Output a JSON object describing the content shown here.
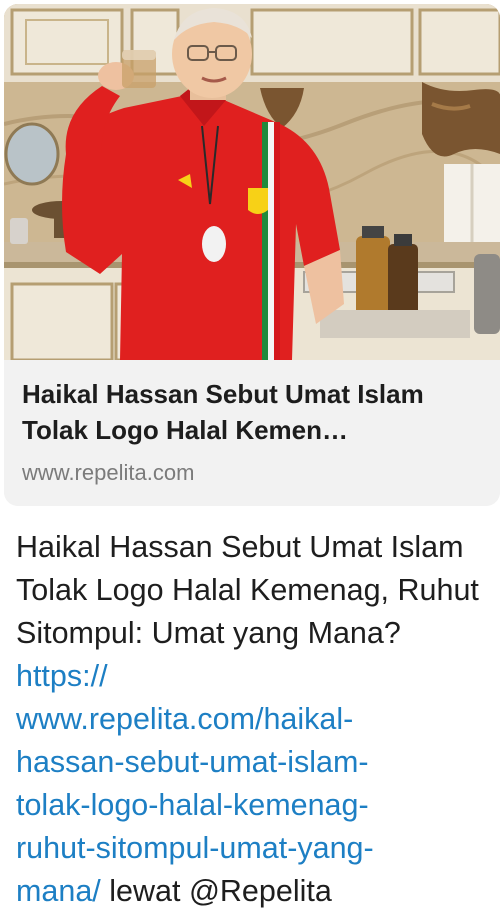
{
  "link_preview": {
    "image_description": "photo",
    "title": "Haikal Hassan Sebut Umat Islam Tolak Logo Halal Kemen…",
    "domain": "www.repelita.com"
  },
  "message": {
    "text_before_link": "Haikal Hassan Sebut Umat Islam Tolak Logo Halal Kemenag, Ruhut Sitompul: Umat yang Mana?",
    "link_line_1": "https://",
    "link_line_2": "www.repelita.com/haikal-",
    "link_line_3": "hassan-sebut-umat-islam-",
    "link_line_4": "tolak-logo-halal-kemenag-",
    "link_line_5": "ruhut-sitompul-umat-yang-",
    "link_line_6": "mana/",
    "text_after_link": "lewat @Repelita"
  },
  "colors": {
    "link": "#1d7fc4",
    "card_background": "#f2f2f2",
    "title_text": "#1d1d1d",
    "domain_text": "#7b7b7b"
  }
}
